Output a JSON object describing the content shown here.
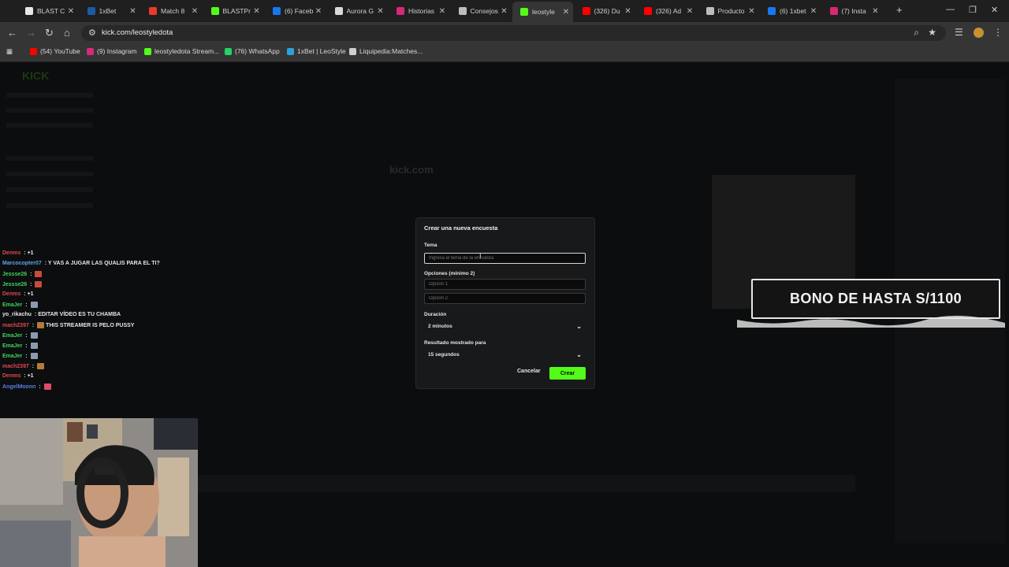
{
  "browser": {
    "tabs": [
      {
        "title": "BLAST C",
        "icon": "blast-icon",
        "color": "#e8e8e8"
      },
      {
        "title": "1xBet",
        "icon": "1xbet-icon",
        "color": "#1a5aa6"
      },
      {
        "title": "Match 8",
        "icon": "dotabuff-icon",
        "color": "#e83a2e"
      },
      {
        "title": "BLASTPr",
        "icon": "kick-icon",
        "color": "#53fc18"
      },
      {
        "title": "(6) Faceb",
        "icon": "facebook-icon",
        "color": "#1877f2"
      },
      {
        "title": "Aurora G",
        "icon": "aurora-icon",
        "color": "#d9d9d9"
      },
      {
        "title": "Historias",
        "icon": "instagram-icon",
        "color": "#d62976"
      },
      {
        "title": "Consejos",
        "icon": "web-icon",
        "color": "#bdbdbd"
      },
      {
        "title": "leostyle",
        "icon": "kick-icon",
        "color": "#53fc18"
      },
      {
        "title": "(326) Du",
        "icon": "youtube-icon",
        "color": "#ff0000"
      },
      {
        "title": "(326) Ad",
        "icon": "youtube-icon",
        "color": "#ff0000"
      },
      {
        "title": "Producto",
        "icon": "web-icon",
        "color": "#bdbdbd"
      },
      {
        "title": "(6) 1xbet",
        "icon": "facebook-icon",
        "color": "#1877f2"
      },
      {
        "title": "(7) Insta",
        "icon": "instagram-icon",
        "color": "#d62976"
      }
    ],
    "active_tab": 8,
    "url": "kick.com/leostyledota",
    "bookmarks": [
      {
        "label": "(54) YouTube",
        "color": "#ff0000"
      },
      {
        "label": "(9) Instagram",
        "color": "#d62976"
      },
      {
        "label": "leostyledota Stream...",
        "color": "#53fc18"
      },
      {
        "label": "(76) WhatsApp",
        "color": "#25d366"
      },
      {
        "label": "1xBet | LeoStyle",
        "color": "#2aa1de"
      },
      {
        "label": "Liquipedia:Matches...",
        "color": "#cfcfcf"
      }
    ]
  },
  "page": {
    "ghost_title": "kick.com",
    "chat": [
      {
        "user": "Denms",
        "color": "#e0474f",
        "text": " : +1"
      },
      {
        "user": "Marcocopter07",
        "color": "#5ea3e8",
        "text": " : Y VAS A JUGAR LAS QUALIS PARA EL TI?"
      },
      {
        "user": "Jessse26",
        "color": "#3fd45a",
        "text": " : ",
        "emote": "#c84a3d"
      },
      {
        "user": "Jessse26",
        "color": "#3fd45a",
        "text": " : ",
        "emote": "#c84a3d"
      },
      {
        "user": "Denms",
        "color": "#e0474f",
        "text": " : +1"
      },
      {
        "user": "EmaJer",
        "color": "#3fd45a",
        "text": " : ",
        "emote": "#8a9bb0"
      },
      {
        "user": "yo_rikachu",
        "color": "#e6e6e6",
        "text": " : EDITAR VÍDEO ES TU CHAMBA"
      },
      {
        "user": "mach2397",
        "color": "#e0474f",
        "text": " : ",
        "emote": "#b47a3a",
        "after": " THIS STREAMER IS PELO PUSSY"
      },
      {
        "user": "EmaJer",
        "color": "#3fd45a",
        "text": " : ",
        "emote": "#8a9bb0"
      },
      {
        "user": "EmaJer",
        "color": "#3fd45a",
        "text": " : ",
        "emote": "#8a9bb0"
      },
      {
        "user": "EmaJer",
        "color": "#3fd45a",
        "text": " : ",
        "emote": "#8a9bb0"
      },
      {
        "user": "mach2397",
        "color": "#e0474f",
        "text": " : ",
        "emote": "#b47a3a"
      },
      {
        "user": "Denms",
        "color": "#e0474f",
        "text": " : +1"
      },
      {
        "user": "AngelMoonn",
        "color": "#5b7fe0",
        "text": " : ",
        "emote": "#e04a6a"
      }
    ],
    "overlay_banner": "BONO DE HASTA S/1100"
  },
  "poll_modal": {
    "title": "Crear una nueva encuesta",
    "topic_label": "Tema",
    "topic_placeholder": "Ingresa el tema de la encuesta",
    "options_label": "Opciones (mínimo 2)",
    "option1_placeholder": "Opción 1",
    "option2_placeholder": "Opción 2",
    "duration_label": "Duración",
    "duration_value": "2 minutos",
    "result_label": "Resultado mostrado para",
    "result_value": "15 segundos",
    "cancel": "Cancelar",
    "create": "Crear",
    "accent": "#53fc18"
  }
}
